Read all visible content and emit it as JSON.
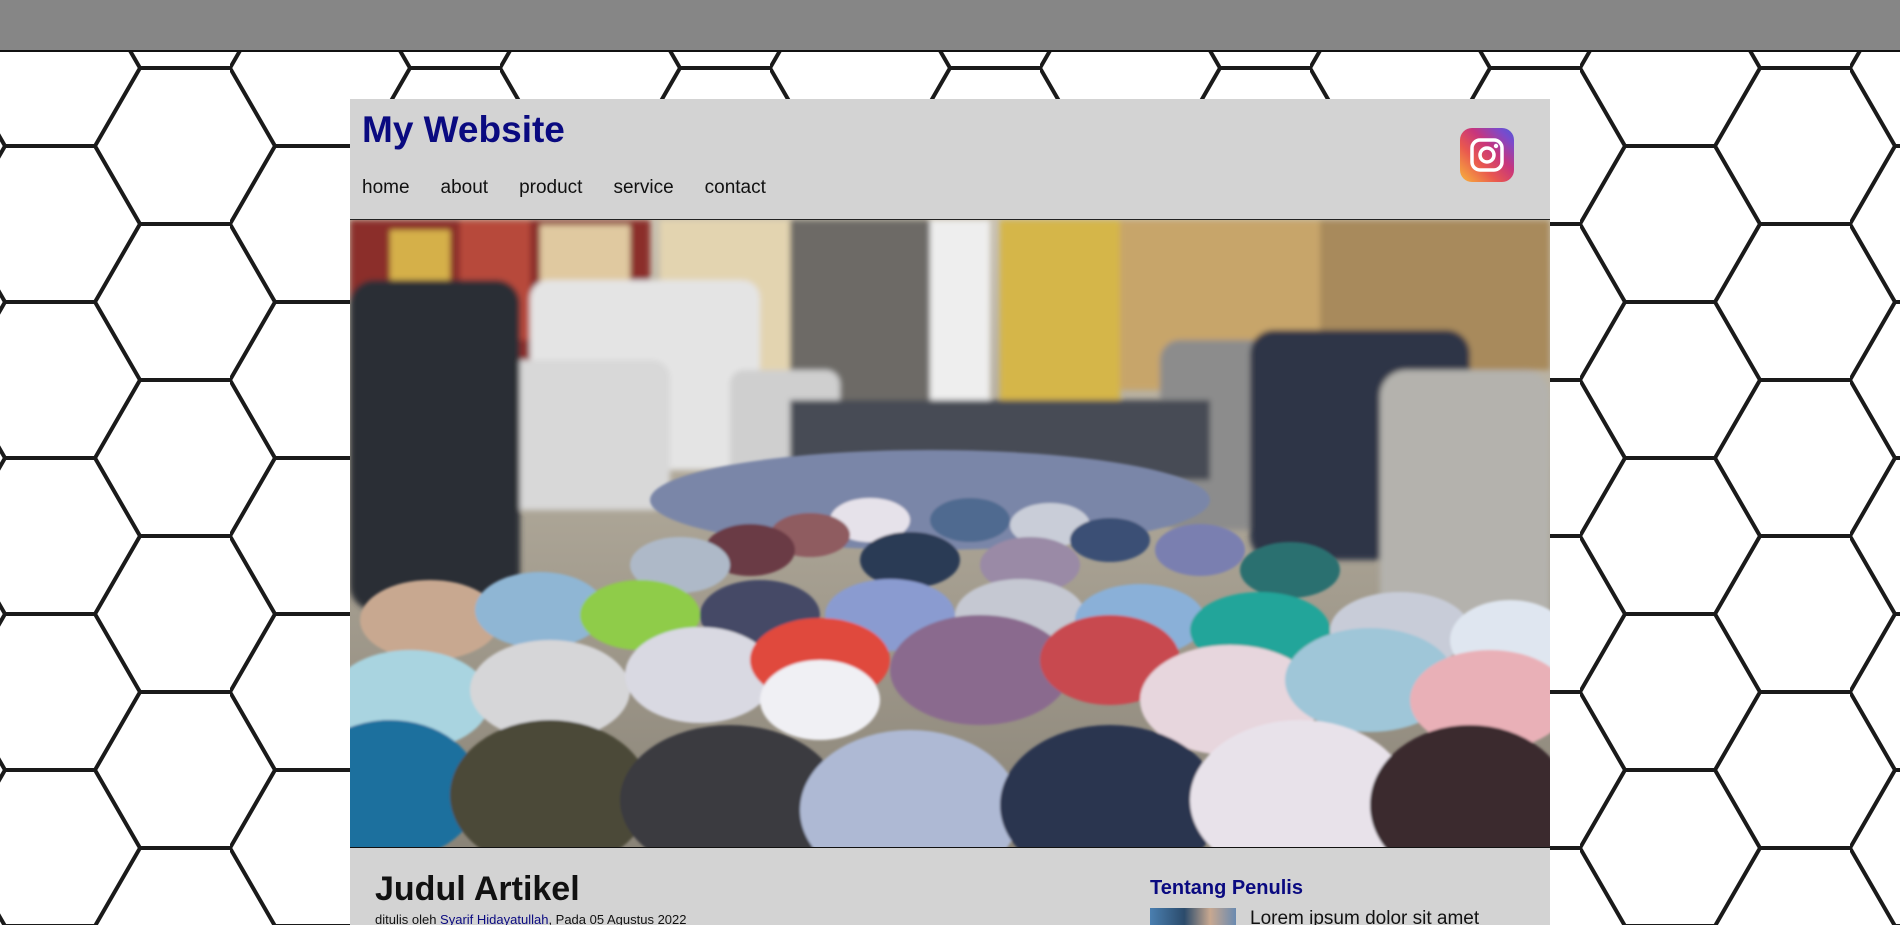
{
  "site": {
    "title": "My Website"
  },
  "nav": {
    "items": [
      "home",
      "about",
      "product",
      "service",
      "contact"
    ]
  },
  "social": {
    "icon": "instagram-icon"
  },
  "article": {
    "title": "Judul Artikel",
    "meta_prefix": "ditulis oleh ",
    "author": "Syarif Hidayatullah",
    "meta_suffix": ", Pada 05 Agustus 2022"
  },
  "sidebar": {
    "title": "Tentang Penulis",
    "text": "Lorem ipsum dolor sit amet"
  },
  "colors": {
    "topbar": "#868686",
    "page_bg": "#d3d3d3",
    "title": "#0a0a80"
  }
}
